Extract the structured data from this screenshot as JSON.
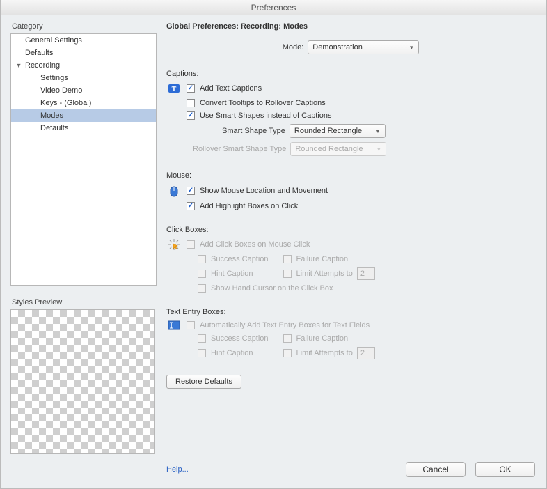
{
  "window": {
    "title": "Preferences"
  },
  "left": {
    "category_label": "Category",
    "styles_preview_label": "Styles Preview",
    "tree": {
      "general_settings": "General Settings",
      "defaults_top": "Defaults",
      "recording": "Recording",
      "settings": "Settings",
      "video_demo": "Video Demo",
      "keys_global": "Keys - (Global)",
      "modes": "Modes",
      "defaults_rec": "Defaults"
    }
  },
  "right": {
    "breadcrumb": "Global Preferences: Recording: Modes",
    "mode_label": "Mode:",
    "mode_value": "Demonstration",
    "captions": {
      "heading": "Captions:",
      "add_text": "Add Text Captions",
      "convert_tooltips": "Convert Tooltips to Rollover Captions",
      "use_smart": "Use Smart Shapes instead of Captions",
      "smart_type_label": "Smart Shape Type",
      "smart_type_value": "Rounded Rectangle",
      "rollover_label": "Rollover Smart Shape Type",
      "rollover_value": "Rounded Rectangle"
    },
    "mouse": {
      "heading": "Mouse:",
      "show_location": "Show Mouse Location and Movement",
      "highlight": "Add Highlight Boxes on Click"
    },
    "clickboxes": {
      "heading": "Click Boxes:",
      "add_click": "Add Click Boxes on Mouse Click",
      "success": "Success Caption",
      "failure": "Failure Caption",
      "hint": "Hint Caption",
      "limit": "Limit Attempts to",
      "limit_val": "2",
      "handcursor": "Show Hand Cursor on the Click Box"
    },
    "textentry": {
      "heading": "Text Entry Boxes:",
      "auto_add": "Automatically Add Text Entry Boxes for Text Fields",
      "success": "Success Caption",
      "failure": "Failure Caption",
      "hint": "Hint Caption",
      "limit": "Limit Attempts to",
      "limit_val": "2"
    },
    "restore": "Restore Defaults",
    "help": "Help...",
    "cancel": "Cancel",
    "ok": "OK"
  }
}
